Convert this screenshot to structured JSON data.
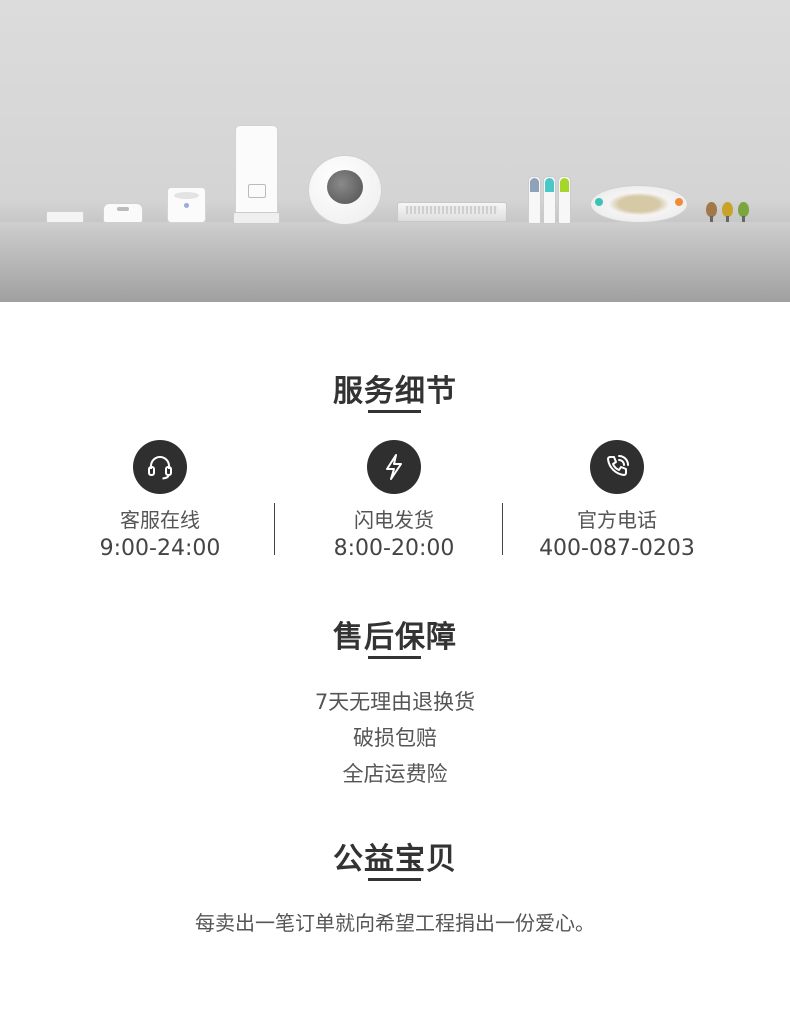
{
  "banner": {
    "products": [
      "sensor-icon",
      "mini-feeder-icon",
      "water-fountain-icon",
      "auto-feeder-icon",
      "round-pet-bed-icon",
      "scratch-board-icon",
      "travel-bottles-icon",
      "cat-toy-track-icon",
      "egg-toys-icon"
    ]
  },
  "service": {
    "title": "服务细节",
    "items": [
      {
        "icon": "headset-icon",
        "label": "客服在线",
        "value": "9:00-24:00"
      },
      {
        "icon": "lightning-icon",
        "label": "闪电发货",
        "value": "8:00-20:00"
      },
      {
        "icon": "phone-icon",
        "label": "官方电话",
        "value": "400-087-0203"
      }
    ]
  },
  "after_sale": {
    "title": "售后保障",
    "items": [
      "7天无理由退换货",
      "破损包赔",
      "全店运费险"
    ]
  },
  "charity": {
    "title": "公益宝贝",
    "text": "每卖出一笔订单就向希望工程捐出一份爱心。"
  },
  "colors": {
    "icon_bg": "#2f2f2f",
    "title_text": "#333333",
    "body_text": "#555555"
  }
}
